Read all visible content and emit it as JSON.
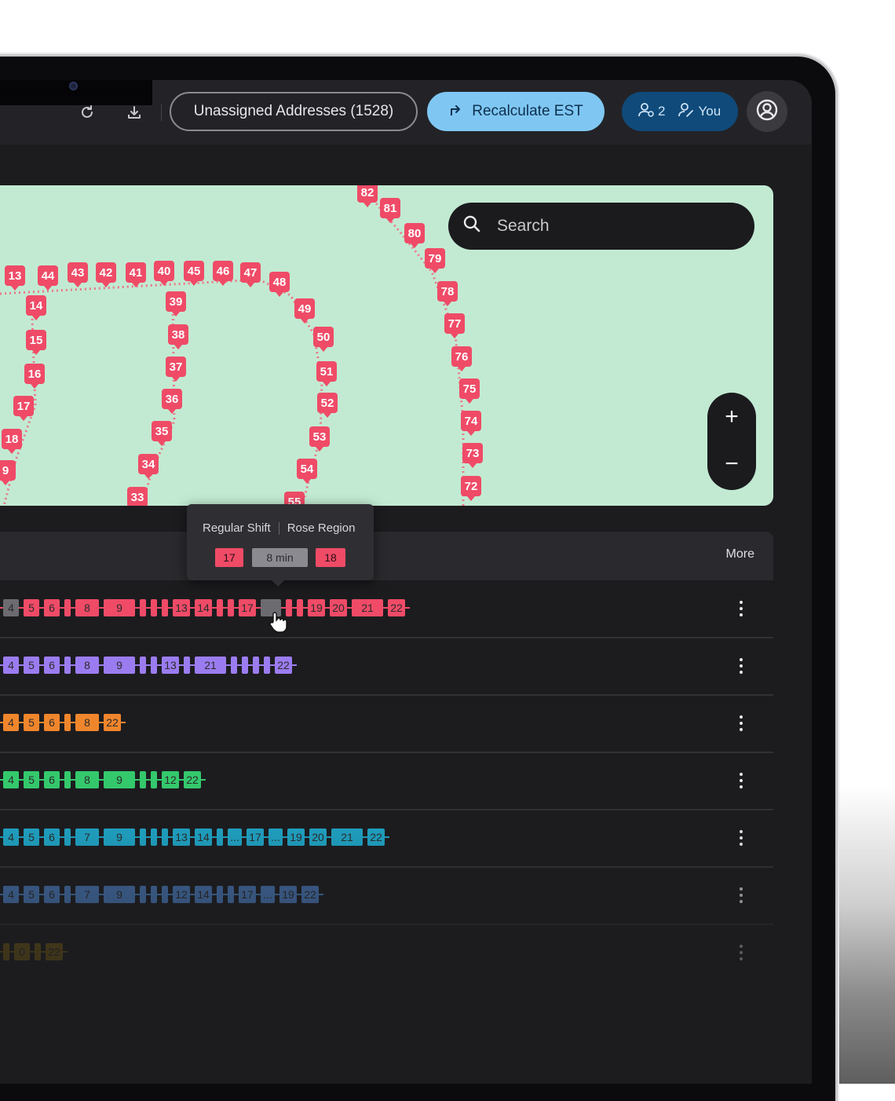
{
  "header": {
    "unassigned_label": "Unassigned Addresses (1528)",
    "recalc_label": "Recalculate EST",
    "users_count": "2",
    "you_label": "You"
  },
  "map": {
    "search_placeholder": "Search",
    "zoom_in": "+",
    "zoom_out": "−",
    "pin_color": "#ef4b67",
    "bg_color": "#c2ead2"
  },
  "tooltip": {
    "shift": "Regular Shift",
    "region": "Rose Region",
    "from_stop": "17",
    "duration": "8 min",
    "to_stop": "18"
  },
  "list": {
    "more_label": "More",
    "rows": [
      {
        "color": "#ef4b67"
      },
      {
        "color": "#9b7cf0"
      },
      {
        "color": "#f0862c"
      },
      {
        "color": "#34c86c"
      },
      {
        "color": "#1fa3c4"
      },
      {
        "color": "#4a7cc0"
      },
      {
        "color": "#8a6a10"
      }
    ]
  },
  "pins": [
    "82",
    "81",
    "80",
    "79",
    "78",
    "77",
    "76",
    "75",
    "74",
    "73",
    "72",
    "13",
    "44",
    "43",
    "42",
    "41",
    "40",
    "45",
    "46",
    "47",
    "48",
    "49",
    "50",
    "51",
    "52",
    "53",
    "54",
    "55",
    "14",
    "15",
    "16",
    "17",
    "18",
    "9",
    "39",
    "38",
    "37",
    "36",
    "35",
    "34",
    "33"
  ],
  "route_rows": [
    [
      "4",
      "5",
      "6",
      "",
      "8",
      "9",
      "",
      "",
      "",
      "13",
      "14",
      "",
      "",
      "17",
      "",
      "",
      "19",
      "20",
      "21",
      "22"
    ],
    [
      "4",
      "5",
      "6",
      "",
      "8",
      "9",
      "",
      "",
      "13",
      "",
      "21",
      "",
      "",
      "",
      "",
      "22"
    ],
    [
      "4",
      "5",
      "6",
      "",
      "8",
      "22"
    ],
    [
      "4",
      "5",
      "6",
      "",
      "8",
      "9",
      "",
      "",
      "12",
      "22"
    ],
    [
      "4",
      "5",
      "6",
      "",
      "7",
      "9",
      "",
      "",
      "",
      "13",
      "14",
      "",
      "...",
      "17",
      "...",
      "19",
      "20",
      "21",
      "22"
    ],
    [
      "4",
      "5",
      "6",
      "",
      "7",
      "9",
      "",
      "",
      "",
      "12",
      "14",
      "",
      "",
      "17",
      "...",
      "19",
      "22"
    ],
    [
      "",
      "0",
      "",
      "22"
    ]
  ]
}
